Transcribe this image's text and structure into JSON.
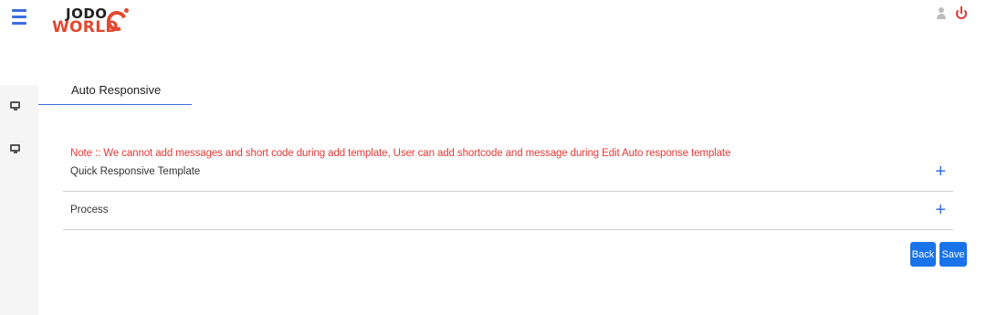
{
  "header": {
    "logo_top": "JODO",
    "logo_bottom": "WORLD",
    "menu_icon": "hamburger-menu-icon",
    "user_icon": "user-icon",
    "power_icon": "power-icon"
  },
  "sidebar": {
    "items": [
      {
        "icon": "monitor-icon"
      },
      {
        "icon": "monitor-icon"
      }
    ]
  },
  "main": {
    "tab_label": "Auto Responsive",
    "note": "Note :: We cannot add messages and short code during add template, User can add shortcode and message during Edit Auto response template",
    "sections": [
      {
        "label": "Quick Responsive Template",
        "expand_symbol": "+"
      },
      {
        "label": "Process",
        "expand_symbol": "+"
      }
    ],
    "back_label": "Back",
    "save_label": "Save"
  },
  "colors": {
    "accent": "#3a6fd8",
    "button": "#1a73e8",
    "note": "#e53935",
    "brand": "#e2492f"
  }
}
